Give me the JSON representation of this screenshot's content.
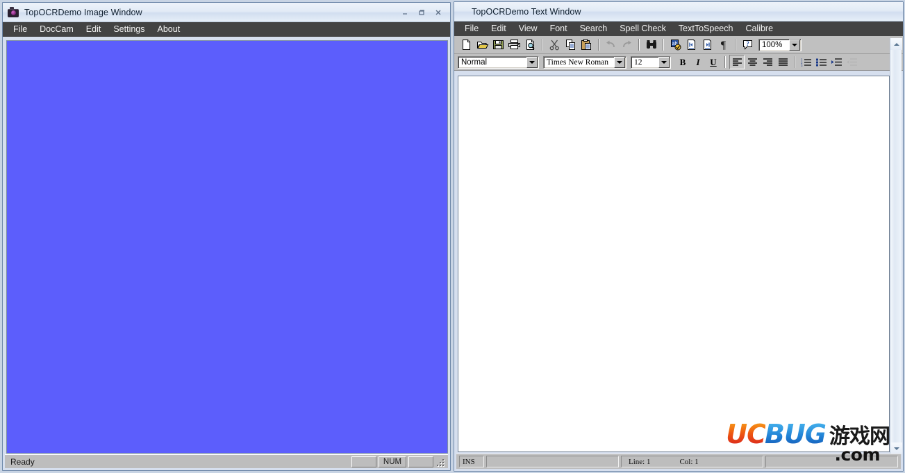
{
  "image_window": {
    "title": "TopOCRDemo Image Window",
    "app_icon": "camera-icon",
    "window_buttons": {
      "minimize": "minimize-icon",
      "maximize": "maximize-icon",
      "close": "close-icon"
    },
    "menu": [
      {
        "label": "File"
      },
      {
        "label": "DocCam"
      },
      {
        "label": "Edit"
      },
      {
        "label": "Settings"
      },
      {
        "label": "About"
      }
    ],
    "canvas": {
      "fill_color": "#5c5efc"
    },
    "statusbar": {
      "message": "Ready",
      "pane_left": "",
      "pane_num": "NUM",
      "pane_right": ""
    }
  },
  "text_window": {
    "title": "TopOCRDemo Text Window",
    "menu": [
      {
        "label": "File"
      },
      {
        "label": "Edit"
      },
      {
        "label": "View"
      },
      {
        "label": "Font"
      },
      {
        "label": "Search"
      },
      {
        "label": "Spell Check"
      },
      {
        "label": "TextToSpeech"
      },
      {
        "label": "Calibre"
      }
    ],
    "toolbar_main": [
      {
        "name": "new-document-icon",
        "tooltip": "New"
      },
      {
        "name": "open-folder-icon",
        "tooltip": "Open"
      },
      {
        "name": "save-disk-icon",
        "tooltip": "Save"
      },
      {
        "name": "print-icon",
        "tooltip": "Print"
      },
      {
        "name": "print-preview-icon",
        "tooltip": "Print Preview"
      },
      {
        "name": "separator"
      },
      {
        "name": "cut-scissors-icon",
        "tooltip": "Cut"
      },
      {
        "name": "copy-icon",
        "tooltip": "Copy"
      },
      {
        "name": "paste-clipboard-icon",
        "tooltip": "Paste"
      },
      {
        "name": "separator"
      },
      {
        "name": "undo-icon",
        "tooltip": "Undo"
      },
      {
        "name": "redo-icon",
        "tooltip": "Redo"
      },
      {
        "name": "separator"
      },
      {
        "name": "find-binoculars-icon",
        "tooltip": "Find"
      },
      {
        "name": "separator"
      },
      {
        "name": "spell-check-icon",
        "tooltip": "Spell Check"
      },
      {
        "name": "page-first-icon",
        "tooltip": "Previous Page"
      },
      {
        "name": "page-last-icon",
        "tooltip": "Next Page"
      },
      {
        "name": "paragraph-marks-icon",
        "tooltip": "Show Paragraph Marks"
      },
      {
        "name": "separator"
      },
      {
        "name": "help-icon",
        "tooltip": "Help"
      }
    ],
    "zoom": {
      "value": "100%"
    },
    "format_toolbar": {
      "style": {
        "value": "Normal"
      },
      "font": {
        "value": "Times New Roman"
      },
      "size": {
        "value": "12"
      },
      "bold": "B",
      "italic": "I",
      "underline": "U",
      "align_left": "align-left-icon",
      "align_center": "align-center-icon",
      "align_right": "align-right-icon",
      "align_justify": "align-justify-icon",
      "numbered_list": "numbered-list-icon",
      "bulleted_list": "bulleted-list-icon",
      "indent_increase": "indent-increase-icon",
      "indent_decrease": "indent-decrease-icon"
    },
    "editor": {
      "content": ""
    },
    "statusbar": {
      "insert_mode": "INS",
      "line_label": "Line: 1",
      "col_label": "Col: 1"
    },
    "scrollbar": {
      "up_arrow": "scroll-up-icon",
      "down_arrow": "scroll-down-icon"
    }
  },
  "watermark": {
    "uc": "UC",
    "bug": "BUG",
    "cn": "游戏网",
    "domain": ".com"
  }
}
